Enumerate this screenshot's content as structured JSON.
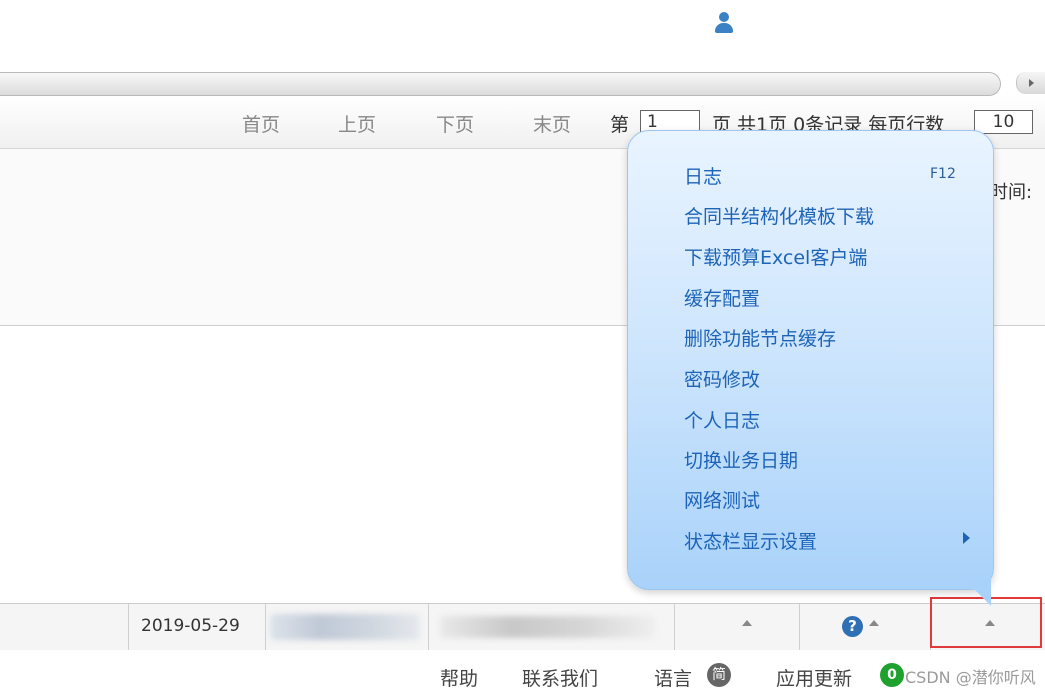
{
  "pager": {
    "first": "首页",
    "prev": "上页",
    "next": "下页",
    "last": "末页",
    "page_prefix": "第",
    "page_value": "1",
    "summary": "页 共1页 0条记录 每页行数",
    "rows_per_page": "10"
  },
  "panel": {
    "time_label": "时间:"
  },
  "popup_menu": {
    "items": [
      {
        "label": "日志",
        "shortcut": "F12"
      },
      {
        "label": "合同半结构化模板下载"
      },
      {
        "label": "下载预算Excel客户端"
      },
      {
        "label": "缓存配置"
      },
      {
        "label": "删除功能节点缓存"
      },
      {
        "label": "密码修改"
      },
      {
        "label": "个人日志"
      },
      {
        "label": "切换业务日期"
      },
      {
        "label": "网络测试"
      },
      {
        "label": "状态栏显示设置",
        "has_submenu": true
      }
    ]
  },
  "statusbar": {
    "date": "2019-05-29",
    "user_icon": "user-icon",
    "help_icon": "help-icon",
    "help_glyph": "?"
  },
  "footer": {
    "help": "帮助",
    "contact": "联系我们",
    "language": "语言",
    "language_badge": "简",
    "update": "应用更新",
    "update_badge": "0",
    "watermark": "CSDN @潜你听风"
  },
  "colors": {
    "menu_text": "#1d64b8",
    "popup_bg": "#cfe6fd",
    "highlight": "#e03a3a",
    "update_badge": "#1fa12e"
  }
}
